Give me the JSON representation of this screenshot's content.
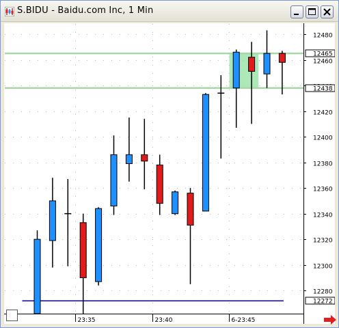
{
  "window": {
    "title": "S.BIDU - Baidu.com Inc, 1 Min"
  },
  "icons": {
    "app": "chart-app-icon",
    "minimize": "minimize-icon",
    "maximize": "maximize-icon",
    "close": "close-icon",
    "scroll_right": "right-arrow-icon"
  },
  "colors": {
    "up_candle": "#1e90ff",
    "down_candle": "#e01b1b",
    "reference_line": "#0000cc",
    "level_line": "#a8d8a8",
    "highlight": "#90e0a0",
    "scroll_arrow": "#e02020"
  },
  "chart_data": {
    "type": "candlestick",
    "symbol": "S.BIDU",
    "interval": "1 Min",
    "ylim": [
      12262,
      12488
    ],
    "y_ticks": [
      12280,
      12300,
      12320,
      12340,
      12360,
      12380,
      12400,
      12420,
      12440,
      12460,
      12480
    ],
    "x_tick_labels": [
      "23:35",
      "23:40",
      "6-23:45"
    ],
    "price_tags": [
      {
        "label": "12465",
        "value": 12465
      },
      {
        "label": "12438",
        "value": 12438
      },
      {
        "label": "12272",
        "value": 12272
      }
    ],
    "candles": [
      {
        "open": 12262,
        "high": 12327,
        "low": 12262,
        "close": 12320,
        "dir": "up"
      },
      {
        "open": 12319,
        "high": 12368,
        "low": 12298,
        "close": 12350,
        "dir": "up"
      },
      {
        "open": 12340,
        "high": 12367,
        "low": 12299,
        "close": 12340,
        "dir": "doji"
      },
      {
        "open": 12333,
        "high": 12340,
        "low": 12262,
        "close": 12290,
        "dir": "down"
      },
      {
        "open": 12287,
        "high": 12345,
        "low": 12284,
        "close": 12344,
        "dir": "up"
      },
      {
        "open": 12346,
        "high": 12401,
        "low": 12339,
        "close": 12386,
        "dir": "up"
      },
      {
        "open": 12379,
        "high": 12415,
        "low": 12365,
        "close": 12386,
        "dir": "up"
      },
      {
        "open": 12386,
        "high": 12414,
        "low": 12359,
        "close": 12381,
        "dir": "down"
      },
      {
        "open": 12378,
        "high": 12386,
        "low": 12339,
        "close": 12348,
        "dir": "down"
      },
      {
        "open": 12340,
        "high": 12358,
        "low": 12339,
        "close": 12357,
        "dir": "up"
      },
      {
        "open": 12356,
        "high": 12360,
        "low": 12285,
        "close": 12331,
        "dir": "down"
      },
      {
        "open": 12342,
        "high": 12434,
        "low": 12342,
        "close": 12433,
        "dir": "up"
      },
      {
        "open": 12434,
        "high": 12448,
        "low": 12383,
        "close": 12434,
        "dir": "doji"
      },
      {
        "open": 12438,
        "high": 12468,
        "low": 12407,
        "close": 12466,
        "dir": "up"
      },
      {
        "open": 12451,
        "high": 12474,
        "low": 12410,
        "close": 12462,
        "dir": "down"
      },
      {
        "open": 12449,
        "high": 12483,
        "low": 12438,
        "close": 12465,
        "dir": "up"
      },
      {
        "open": 12465,
        "high": 12467,
        "low": 12433,
        "close": 12458,
        "dir": "down"
      }
    ],
    "horizontal_lines": [
      {
        "value": 12465,
        "style": "level"
      },
      {
        "value": 12438,
        "style": "level"
      },
      {
        "value": 12272,
        "style": "reference"
      }
    ],
    "highlight_range": {
      "low": 12438,
      "high": 12465,
      "from_candle": 13,
      "to_candle": 14
    },
    "grid": true
  }
}
